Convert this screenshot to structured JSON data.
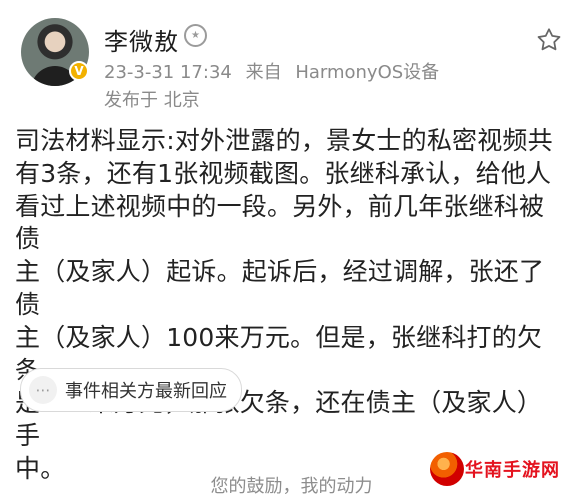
{
  "header": {
    "username": "李微敖",
    "time_source": "23-3-31 17:34",
    "from_label": "来自",
    "device": "HarmonyOS设备",
    "location": "发布于 北京"
  },
  "post": {
    "text": "司法材料显示:对外泄露的，景女士的私密视频共\n有3条，还有1张视频截图。张继科承认，给他人\n看过上述视频中的一段。另外，前几年张继科被债\n主（及家人）起诉。起诉后，经过调解，张还了债\n主（及家人）100来万元。但是，张继科打的欠条\n是500来万元，那张欠条，还在债主（及家人）手\n中。"
  },
  "related": {
    "label": "事件相关方最新回应"
  },
  "footer": {
    "text": "您的鼓励，我的动力"
  },
  "watermark": {
    "text": "华南手游网"
  },
  "icons": {
    "verified": "verified-badge-icon",
    "medal": "medal-icon",
    "star": "star-icon",
    "related": "dots-icon",
    "watermark_logo": "watermark-logo-icon"
  },
  "colors": {
    "accent_badge": "#f2b100",
    "meta_text": "#8a8a8a",
    "watermark": "#e4131f"
  }
}
